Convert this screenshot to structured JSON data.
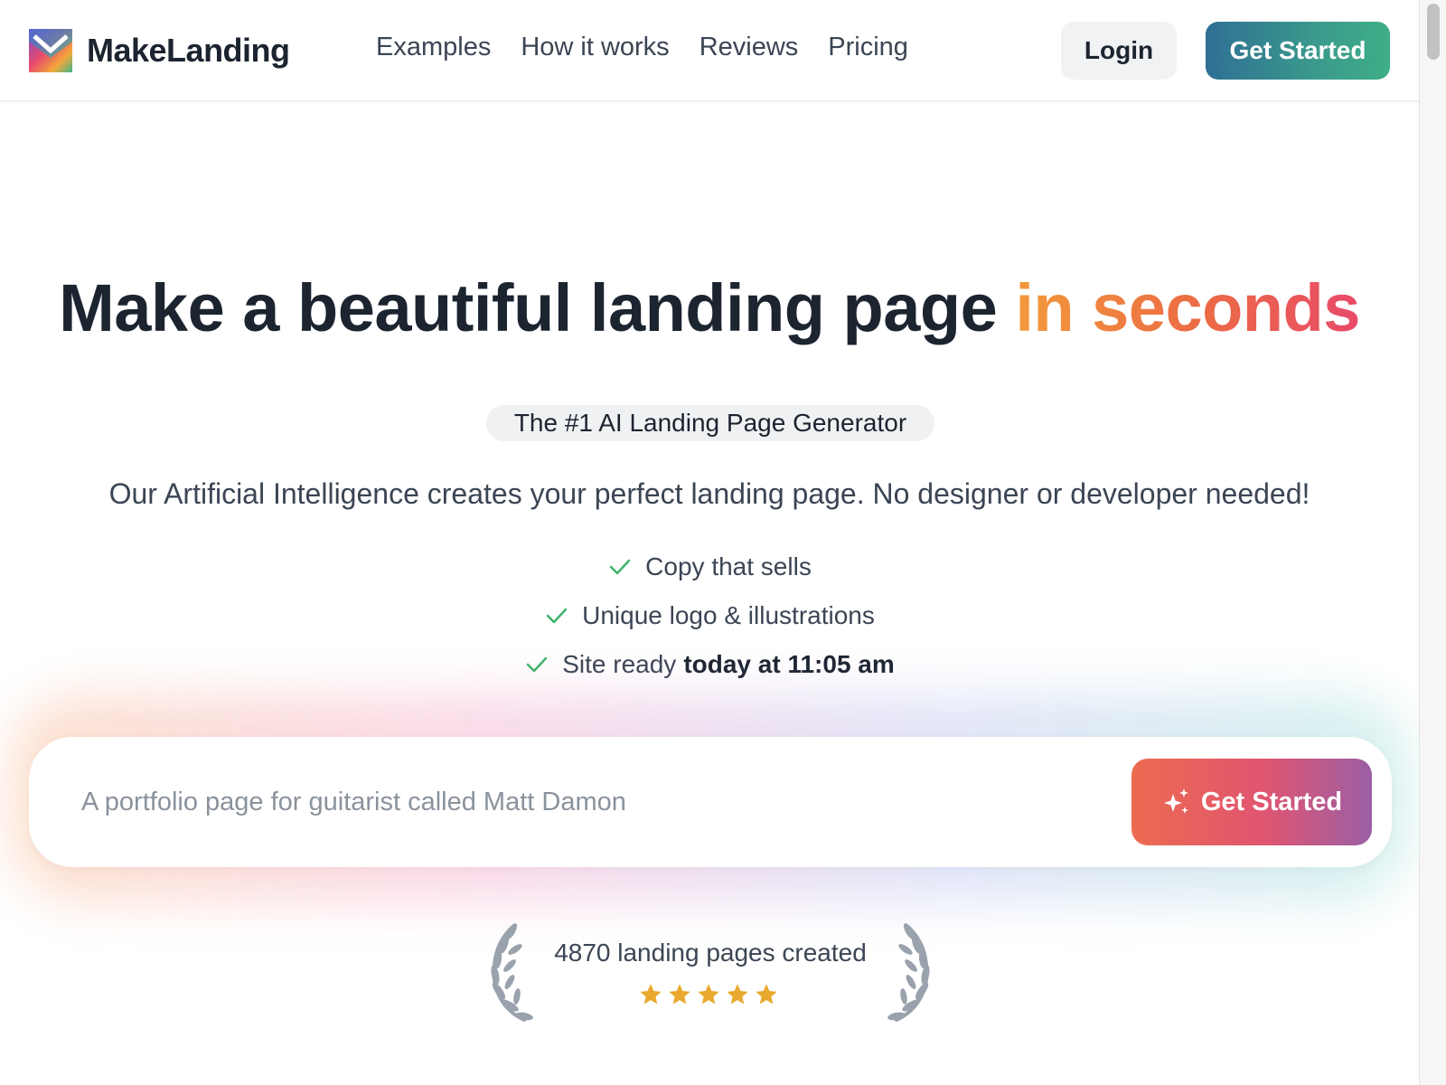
{
  "header": {
    "brand": "MakeLanding",
    "nav": [
      {
        "label": "Examples"
      },
      {
        "label": "How it works"
      },
      {
        "label": "Reviews"
      },
      {
        "label": "Pricing"
      }
    ],
    "login_label": "Login",
    "get_started_label": "Get Started"
  },
  "hero": {
    "title_main": "Make a beautiful landing page ",
    "title_accent": "in seconds",
    "badge": "The #1 AI Landing Page Generator",
    "subtitle": "Our Artificial Intelligence creates your perfect landing page. No designer or developer needed!",
    "features": [
      {
        "text": "Copy that sells",
        "bold": ""
      },
      {
        "text": "Unique logo & illustrations",
        "bold": ""
      },
      {
        "text": "Site ready",
        "bold": "today at 11:05 am"
      }
    ]
  },
  "prompt": {
    "placeholder": "A portfolio page for guitarist called Matt Damon",
    "value": "",
    "button_label": "Get Started"
  },
  "stats": {
    "text": "4870 landing pages created",
    "rating_stars": 5
  },
  "colors": {
    "accent_orange": "#f29a3b",
    "accent_pink": "#e84a6a",
    "header_button": "#2f6f94",
    "check": "#3fb36a",
    "star": "#e9a92e",
    "laurel": "#9aa2ad"
  }
}
